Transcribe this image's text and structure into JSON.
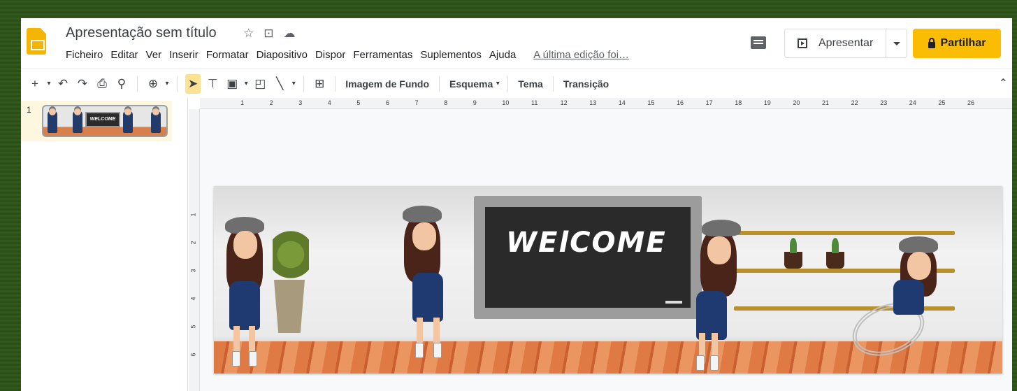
{
  "window": {
    "doc_title": "Apresentação sem título",
    "title_icons": [
      "star-icon",
      "move-to-folder-icon",
      "cloud-saved-icon"
    ]
  },
  "menu": {
    "items": [
      "Ficheiro",
      "Editar",
      "Ver",
      "Inserir",
      "Formatar",
      "Diapositivo",
      "Dispor",
      "Ferramentas",
      "Suplementos",
      "Ajuda"
    ],
    "last_edit": "A última edição foi…"
  },
  "header_actions": {
    "present_label": "Apresentar",
    "share_label": "Partilhar",
    "share_color": "#fbbc04"
  },
  "toolbar": {
    "background_label": "Imagem de Fundo",
    "layout_label": "Esquema",
    "theme_label": "Tema",
    "transition_label": "Transição"
  },
  "filmstrip": {
    "slides": [
      {
        "number": "1",
        "thumb_text": "WELCOME"
      }
    ]
  },
  "ruler": {
    "top_numbers": [
      "1",
      "2",
      "3",
      "4",
      "5",
      "6",
      "7",
      "8",
      "9",
      "10",
      "11",
      "12",
      "13",
      "14",
      "15",
      "16",
      "17",
      "18",
      "19",
      "20",
      "21",
      "22",
      "23",
      "24",
      "25",
      "26"
    ],
    "left_numbers": [
      "1",
      "2",
      "3",
      "4",
      "5",
      "6"
    ]
  },
  "slide": {
    "board_text": "WElCOME"
  }
}
